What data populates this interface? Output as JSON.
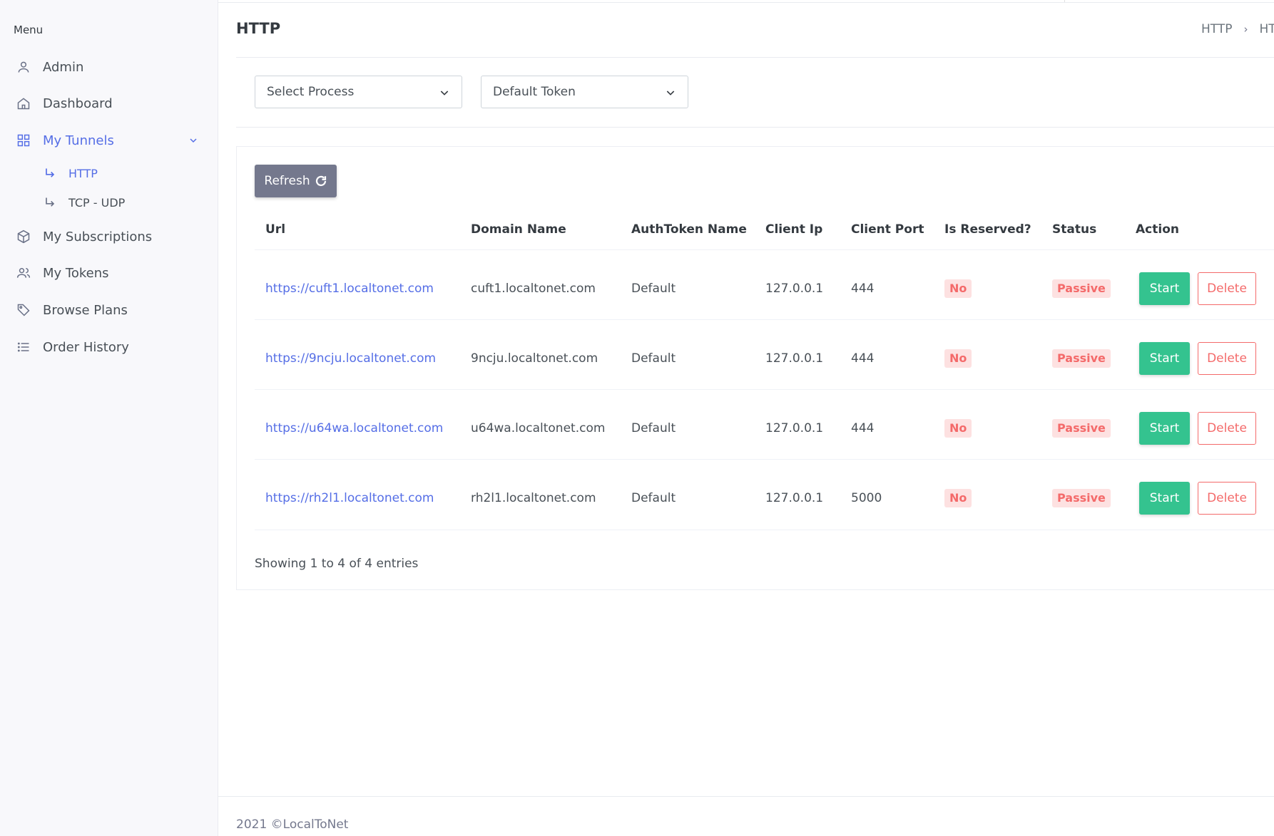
{
  "sidebar": {
    "menu_title": "Menu",
    "items": [
      {
        "label": "Admin",
        "icon": "user-icon"
      },
      {
        "label": "Dashboard",
        "icon": "home-icon"
      },
      {
        "label": "My Tunnels",
        "icon": "grid-icon"
      },
      {
        "label": "My Subscriptions",
        "icon": "box-icon"
      },
      {
        "label": "My Tokens",
        "icon": "users-icon"
      },
      {
        "label": "Browse Plans",
        "icon": "tag-icon"
      },
      {
        "label": "Order History",
        "icon": "list-icon"
      }
    ],
    "sub_items": [
      {
        "label": "HTTP"
      },
      {
        "label": "TCP - UDP"
      }
    ]
  },
  "header": {
    "title": "HTTP",
    "breadcrumb": [
      "HTTP",
      "HT"
    ]
  },
  "filters": {
    "process_select": "Select Process",
    "token_select": "Default Token"
  },
  "toolbar": {
    "refresh_label": "Refresh"
  },
  "table": {
    "columns": [
      "Url",
      "Domain Name",
      "AuthToken Name",
      "Client Ip",
      "Client Port",
      "Is Reserved?",
      "Status",
      "Action"
    ],
    "rows": [
      {
        "url": "https://cuft1.localtonet.com",
        "domain": "cuft1.localtonet.com",
        "token": "Default",
        "ip": "127.0.0.1",
        "port": "444",
        "reserved": "No",
        "status": "Passive"
      },
      {
        "url": "https://9ncju.localtonet.com",
        "domain": "9ncju.localtonet.com",
        "token": "Default",
        "ip": "127.0.0.1",
        "port": "444",
        "reserved": "No",
        "status": "Passive"
      },
      {
        "url": "https://u64wa.localtonet.com",
        "domain": "u64wa.localtonet.com",
        "token": "Default",
        "ip": "127.0.0.1",
        "port": "444",
        "reserved": "No",
        "status": "Passive"
      },
      {
        "url": "https://rh2l1.localtonet.com",
        "domain": "rh2l1.localtonet.com",
        "token": "Default",
        "ip": "127.0.0.1",
        "port": "5000",
        "reserved": "No",
        "status": "Passive"
      }
    ],
    "start_label": "Start",
    "delete_label": "Delete",
    "showing": "Showing 1 to 4 of 4 entries"
  },
  "footer": {
    "text": "2021 ©LocalToNet"
  },
  "colors": {
    "accent": "#556ee6",
    "success": "#34c38f",
    "danger": "#f46a6a",
    "secondary": "#74788d"
  }
}
